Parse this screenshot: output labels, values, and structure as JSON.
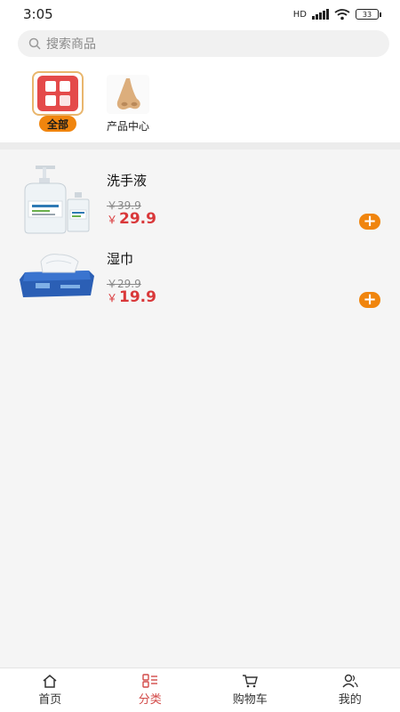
{
  "status_bar": {
    "time": "3:05",
    "network": "HD",
    "battery": "33"
  },
  "search": {
    "placeholder": "搜索商品"
  },
  "categories": [
    {
      "label": "全部",
      "icon": "grid-icon",
      "selected": true
    },
    {
      "label": "产品中心",
      "icon": "nose-icon",
      "selected": false
    }
  ],
  "products": [
    {
      "name": "洗手液",
      "old_price": "￥39.9",
      "currency": "￥",
      "price": "29.9",
      "thumb": "hand-sanitizer-bottles"
    },
    {
      "name": "湿巾",
      "old_price": "￥29.9",
      "currency": "￥",
      "price": "19.9",
      "thumb": "wet-wipes-pack"
    }
  ],
  "tabbar": {
    "items": [
      {
        "label": "首页",
        "icon": "home-icon"
      },
      {
        "label": "分类",
        "icon": "category-icon",
        "active": true
      },
      {
        "label": "购物车",
        "icon": "cart-icon"
      },
      {
        "label": "我的",
        "icon": "user-icon"
      }
    ]
  },
  "colors": {
    "accent": "#f0850e",
    "price": "#d9383a",
    "active_tab": "#d24a48"
  }
}
